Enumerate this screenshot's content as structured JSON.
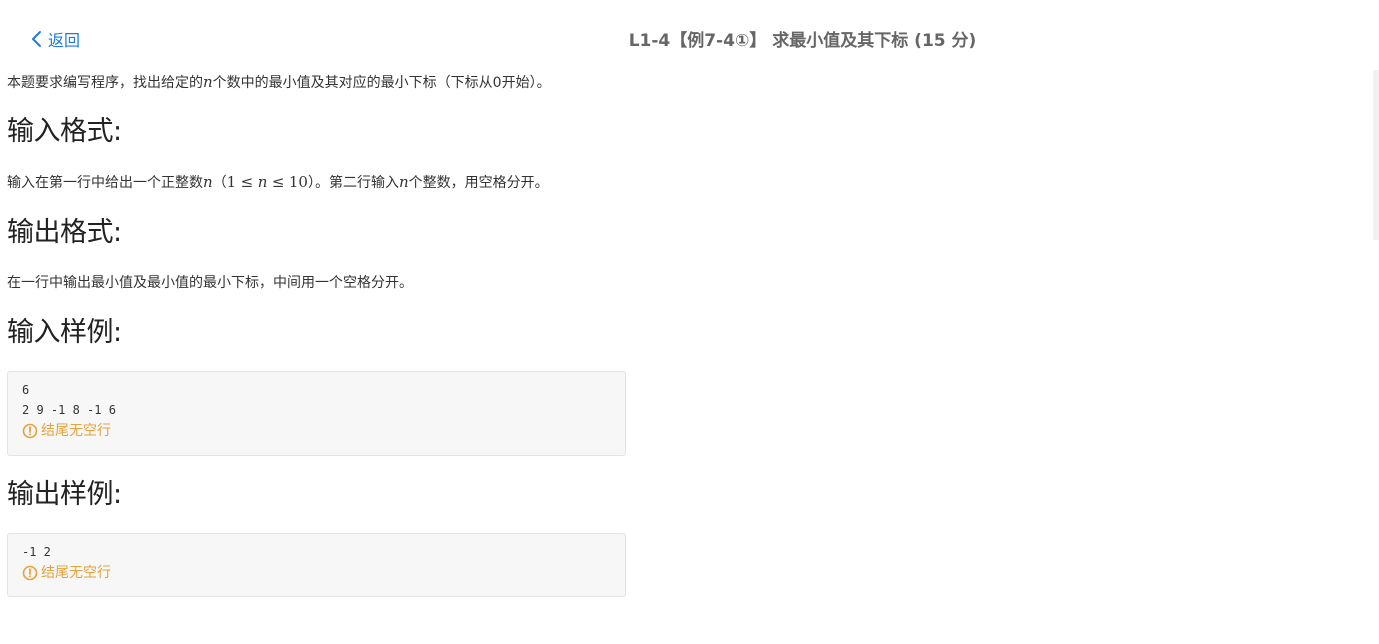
{
  "header": {
    "back_label": "返回",
    "title": "L1-4【例7-4①】 求最小值及其下标 (15 分)"
  },
  "description": {
    "prefix": "本题要求编写程序，找出给定的",
    "var": "n",
    "suffix": "个数中的最小值及其对应的最小下标（下标从0开始）。"
  },
  "input_format": {
    "heading": "输入格式:",
    "part1": "输入在第一行中给出一个正整数",
    "var": "n",
    "open": "（",
    "range_one": "1",
    "le1": "≤",
    "range_n": "n",
    "le2": "≤",
    "range_ten": "10",
    "close": "）",
    "part2": "。第二行输入",
    "var2": "n",
    "part3": "个整数，用空格分开。"
  },
  "output_format": {
    "heading": "输出格式:",
    "text": "在一行中输出最小值及最小值的最小下标，中间用一个空格分开。"
  },
  "sample_input": {
    "heading": "输入样例:",
    "lines": [
      "6",
      "2 9 -1 8 -1 6"
    ],
    "note": "结尾无空行"
  },
  "sample_output": {
    "heading": "输出样例:",
    "lines": [
      "-1 2"
    ],
    "note": "结尾无空行"
  },
  "colors": {
    "link": "#1f7ae0",
    "warning": "#e6a23c"
  }
}
